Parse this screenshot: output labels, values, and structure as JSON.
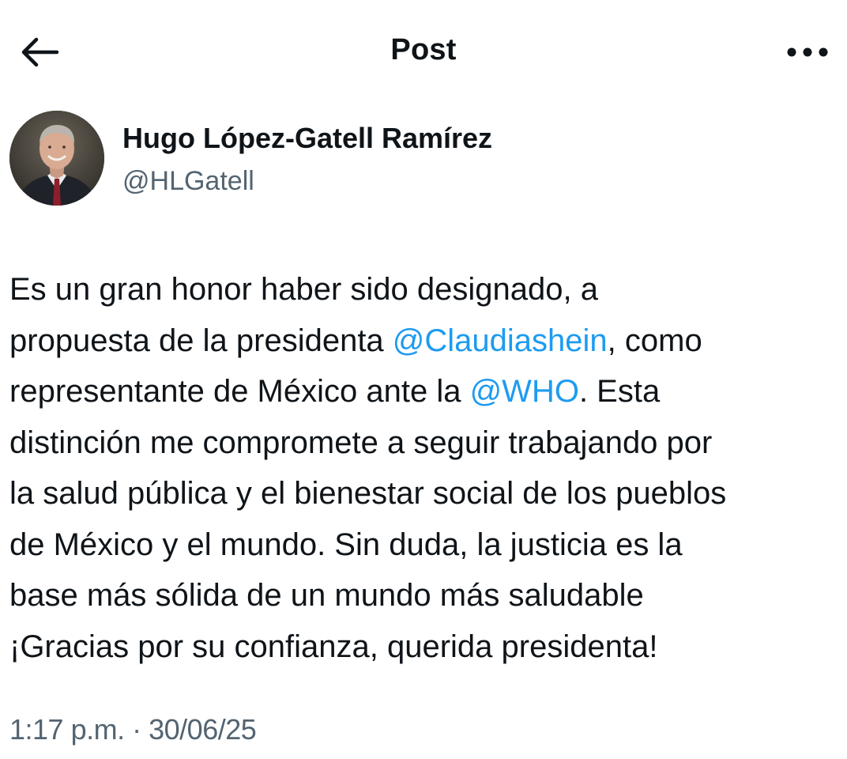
{
  "header": {
    "title": "Post",
    "back_icon": "arrow-left-icon",
    "more_icon": "more-horizontal-icon"
  },
  "author": {
    "name": "Hugo López-Gatell Ramírez",
    "handle": "@HLGatell"
  },
  "post": {
    "lines": [
      [
        {
          "t": "Es un gran honor haber sido designado, a"
        }
      ],
      [
        {
          "t": "propuesta de la presidenta "
        },
        {
          "t": "@Claudiashein",
          "m": true
        },
        {
          "t": ", como"
        }
      ],
      [
        {
          "t": "representante de México ante la "
        },
        {
          "t": "@WHO",
          "m": true
        },
        {
          "t": ". Esta"
        }
      ],
      [
        {
          "t": "distinción me compromete a seguir trabajando por"
        }
      ],
      [
        {
          "t": "la salud pública y el bienestar social de los pueblos"
        }
      ],
      [
        {
          "t": "de México y el mundo. Sin duda, la justicia es la"
        }
      ],
      [
        {
          "t": "base más sólida de un mundo más saludable"
        }
      ],
      [
        {
          "t": "¡Gracias por su confianza, querida presidenta!"
        }
      ]
    ]
  },
  "meta": {
    "time": "1:17 p.m.",
    "separator": "·",
    "date": "30/06/25"
  },
  "colors": {
    "mention": "#1d9bf0",
    "secondary_text": "#536471",
    "primary_text": "#0f1419"
  }
}
